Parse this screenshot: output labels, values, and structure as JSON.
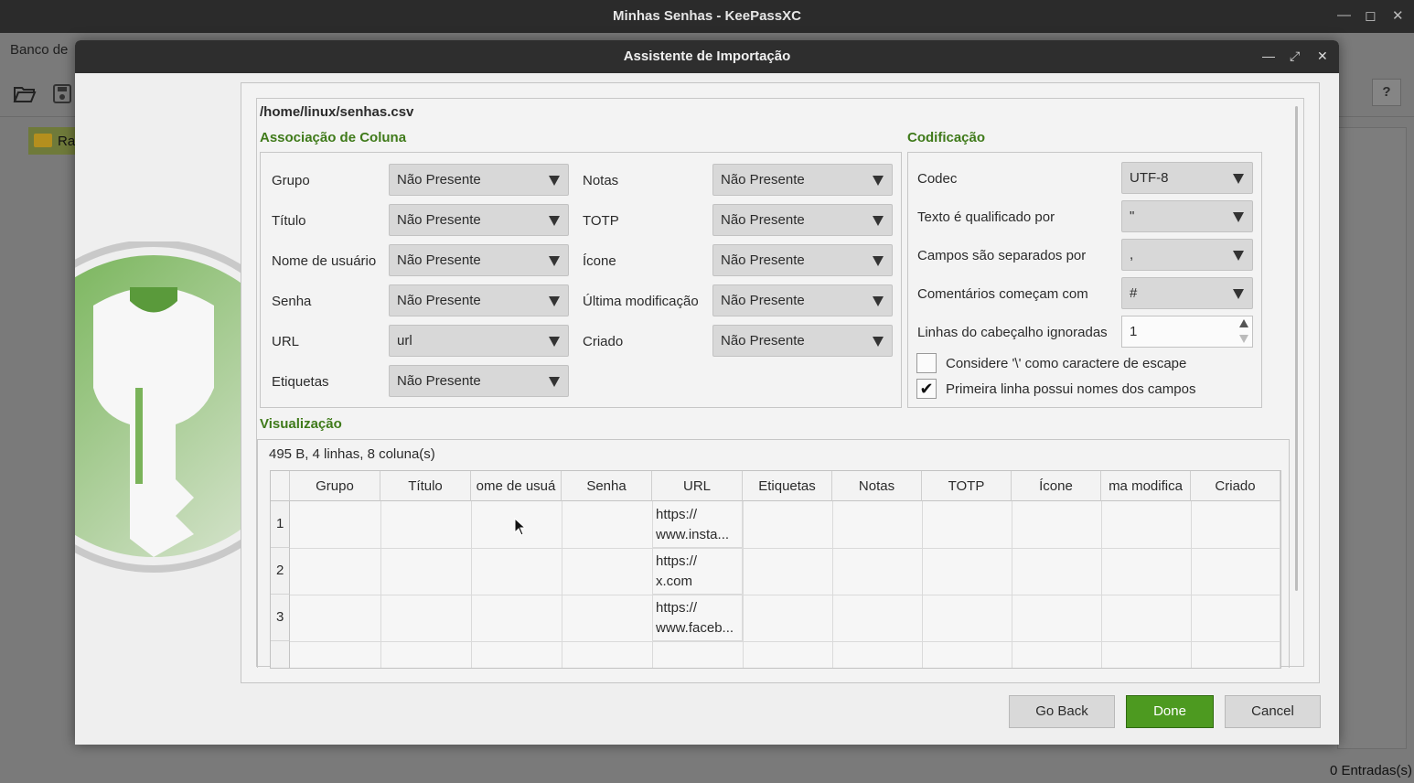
{
  "main_window": {
    "title": "Minhas Senhas - KeePassXC",
    "menu_partial": "Banco de",
    "help_label": "?",
    "sidebar_folder": "Ra",
    "status": "0 Entradas(s)"
  },
  "dialog": {
    "title": "Assistente de Importação",
    "file_path": "/home/linux/senhas.csv",
    "assoc_title": "Associação de Coluna",
    "encoding_title": "Codificação",
    "preview_title": "Visualização",
    "preview_stats": "495 B, 4 linhas, 8 coluna(s)",
    "assoc_left": [
      {
        "label": "Grupo",
        "value": "Não Presente"
      },
      {
        "label": "Título",
        "value": "Não Presente"
      },
      {
        "label": "Nome de usuário",
        "value": "Não Presente"
      },
      {
        "label": "Senha",
        "value": "Não Presente"
      },
      {
        "label": "URL",
        "value": "url"
      },
      {
        "label": "Etiquetas",
        "value": "Não Presente"
      }
    ],
    "assoc_right": [
      {
        "label": "Notas",
        "value": "Não Presente"
      },
      {
        "label": "TOTP",
        "value": "Não Presente"
      },
      {
        "label": "Ícone",
        "value": "Não Presente"
      },
      {
        "label": "Última modificação",
        "value": "Não Presente"
      },
      {
        "label": "Criado",
        "value": "Não Presente"
      }
    ],
    "encoding": {
      "codec_label": "Codec",
      "codec_value": "UTF-8",
      "qualifier_label": "Texto é qualificado por",
      "qualifier_value": "\"",
      "separator_label": "Campos são separados por",
      "separator_value": ",",
      "comments_label": "Comentários começam com",
      "comments_value": "#",
      "header_lines_label": "Linhas do cabeçalho ignoradas",
      "header_lines_value": "1",
      "escape_label": "Considere '\\' como caractere de escape",
      "escape_checked": false,
      "first_line_label": "Primeira linha possui nomes dos campos",
      "first_line_checked": true,
      "check_mark": "✔"
    },
    "table": {
      "headers": [
        "Grupo",
        "Título",
        "ome de usuá",
        "Senha",
        "URL",
        "Etiquetas",
        "Notas",
        "TOTP",
        "Ícone",
        "ma modifica",
        "Criado"
      ],
      "rows": [
        {
          "num": "1",
          "url_line1": "https://",
          "url_line2": "www.insta..."
        },
        {
          "num": "2",
          "url_line1": "https://",
          "url_line2": "x.com"
        },
        {
          "num": "3",
          "url_line1": "https://",
          "url_line2": "www.faceb..."
        }
      ]
    },
    "buttons": {
      "back": "Go Back",
      "done": "Done",
      "cancel": "Cancel"
    }
  },
  "colors": {
    "accent": "#4d9a20",
    "section": "#3f7a1a",
    "titlebar": "#2e2e2e"
  }
}
